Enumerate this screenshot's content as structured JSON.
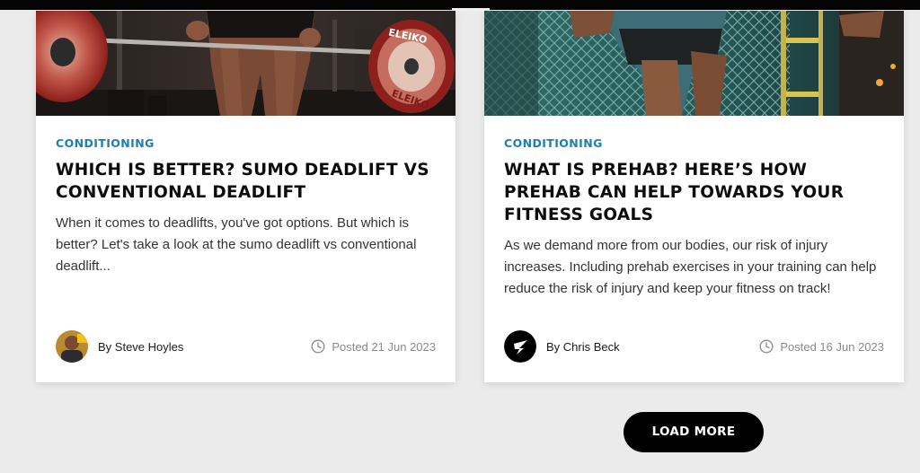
{
  "articles": [
    {
      "image_alt": "sumo deadlift barbell photo",
      "category": "CONDITIONING",
      "title": "WHICH IS BETTER? SUMO DEADLIFT VS CONVENTIONAL DEADLIFT",
      "excerpt": "When it comes to deadlifts, you've got options. But which is better? Let's take a look at the sumo deadlift vs conventional deadlift...",
      "author": "By Steve Hoyles",
      "posted": "Posted 21 Jun 2023",
      "plate_text_top": "ELEIKO",
      "plate_text_bottom": "ELEIKO"
    },
    {
      "image_alt": "athlete lunging in gym photo",
      "category": "CONDITIONING",
      "title": "WHAT IS PREHAB? HERE’S HOW PREHAB CAN HELP TOWARDS YOUR FITNESS GOALS",
      "excerpt": "As we demand more from our bodies, our risk of injury increases. Including prehab exercises in your training can help reduce the risk of injury and keep your fitness on track!",
      "author": "By Chris Beck",
      "posted": "Posted 16 Jun 2023"
    }
  ],
  "load_more_label": "LOAD MORE",
  "colors": {
    "category": "#1a7fb4",
    "background": "#ebebeb",
    "button": "#000000"
  },
  "icons": [
    "clock-icon",
    "gymshark-logo-icon"
  ]
}
